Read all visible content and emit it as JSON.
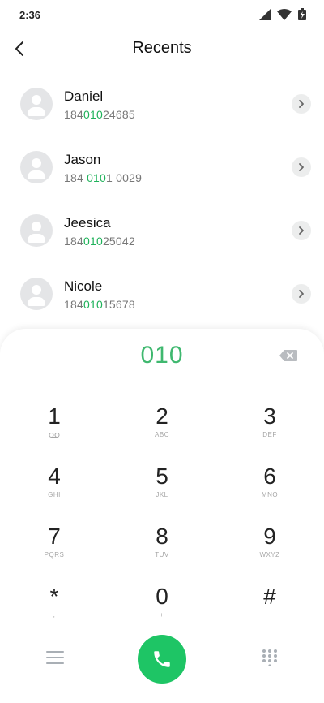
{
  "status_bar": {
    "time": "2:36",
    "icons": [
      "signal-icon",
      "wifi-icon",
      "battery-charging-icon"
    ]
  },
  "app_bar": {
    "title": "Recents",
    "back_icon": "chevron-left-icon"
  },
  "recents": [
    {
      "name": "Daniel",
      "number_before": "184",
      "number_match": "010",
      "number_after": "24685"
    },
    {
      "name": "Jason",
      "number_before": "184 ",
      "number_match": "010",
      "number_after": "1 0029"
    },
    {
      "name": "Jeesica",
      "number_before": "184",
      "number_match": "010",
      "number_after": "25042"
    },
    {
      "name": "Nicole",
      "number_before": "184",
      "number_match": "010",
      "number_after": "15678"
    }
  ],
  "dialpad": {
    "typed_number": "010",
    "keys": [
      {
        "digit": "1",
        "letters": "voicemail"
      },
      {
        "digit": "2",
        "letters": "ABC"
      },
      {
        "digit": "3",
        "letters": "DEF"
      },
      {
        "digit": "4",
        "letters": "GHI"
      },
      {
        "digit": "5",
        "letters": "JKL"
      },
      {
        "digit": "6",
        "letters": "MNO"
      },
      {
        "digit": "7",
        "letters": "PQRS"
      },
      {
        "digit": "8",
        "letters": "TUV"
      },
      {
        "digit": "9",
        "letters": "WXYZ"
      },
      {
        "digit": "*",
        "letters": ","
      },
      {
        "digit": "0",
        "letters": "+"
      },
      {
        "digit": "#",
        "letters": ""
      }
    ]
  },
  "colors": {
    "accent_green": "#1ec565",
    "match_green": "#1fb25a",
    "display_green": "#3fb86f"
  }
}
